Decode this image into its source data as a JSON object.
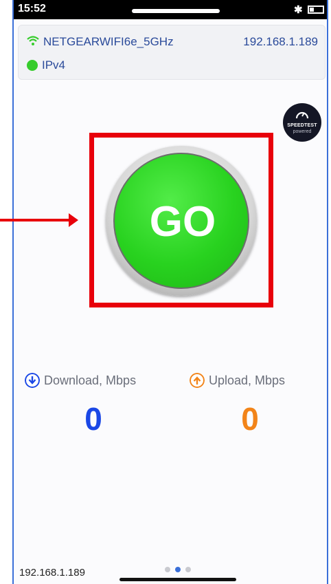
{
  "status_bar": {
    "time": "15:52",
    "bluetooth_icon": "bluetooth-icon",
    "battery_icon": "battery-icon"
  },
  "network": {
    "ssid": "NETGEARWIFI6e_5GHz",
    "ip_address": "192.168.1.189",
    "protocol": "IPv4",
    "wifi_icon": "wifi-icon",
    "status_color": "#36cc2c"
  },
  "badge": {
    "line1": "SPEEDTEST",
    "line2": "powered",
    "icon": "gauge-icon"
  },
  "go_button": {
    "label": "GO",
    "color": "#28d21f"
  },
  "highlight": {
    "color": "#e8000b"
  },
  "metrics": {
    "download": {
      "label": "Download, Mbps",
      "value": "0",
      "color": "#1a47e6",
      "icon": "download-arrow-icon"
    },
    "upload": {
      "label": "Upload, Mbps",
      "value": "0",
      "color": "#f28419",
      "icon": "upload-arrow-icon"
    }
  },
  "footer": {
    "ip_address": "192.168.1.189",
    "page_count": 3,
    "active_page": 2
  }
}
